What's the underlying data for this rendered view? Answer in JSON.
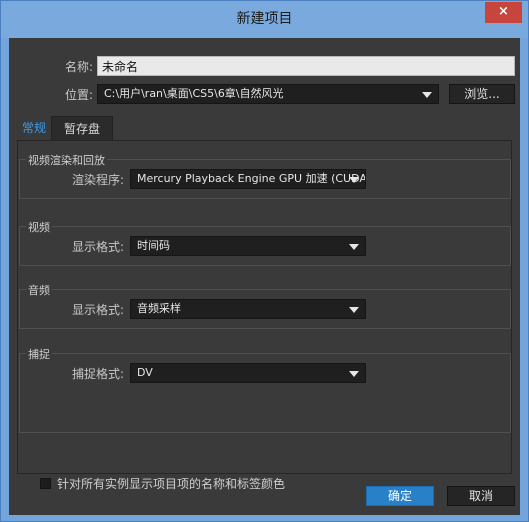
{
  "window": {
    "title": "新建项目",
    "close_glyph": "×",
    "close_icon": "close-icon"
  },
  "general": {
    "name_label": "名称:",
    "name_value": "未命名",
    "location_label": "位置:",
    "location_value": "C:\\用户\\ran\\桌面\\CS5\\6章\\自然风光",
    "browse_label": "浏览..."
  },
  "tabs": [
    {
      "label": "常规",
      "active": true
    },
    {
      "label": "暂存盘",
      "active": false
    }
  ],
  "groups": {
    "render": {
      "title": "视频渲染和回放",
      "field_label": "渲染程序:",
      "value": "Mercury Playback Engine GPU 加速 (CUDA"
    },
    "video": {
      "title": "视频",
      "field_label": "显示格式:",
      "value": "时间码"
    },
    "audio": {
      "title": "音频",
      "field_label": "显示格式:",
      "value": "音频采样"
    },
    "capture": {
      "title": "捕捉",
      "field_label": "捕捉格式:",
      "value": "DV"
    }
  },
  "options": {
    "show_colors_label": "针对所有实例显示项目项的名称和标签颜色",
    "show_colors_checked": false
  },
  "footer": {
    "ok_label": "确定",
    "cancel_label": "取消"
  },
  "colors": {
    "accent": "#2880c9",
    "title_bar": "#7aa9de",
    "close": "#c7453c",
    "panel_bg": "#3a3a3a"
  }
}
